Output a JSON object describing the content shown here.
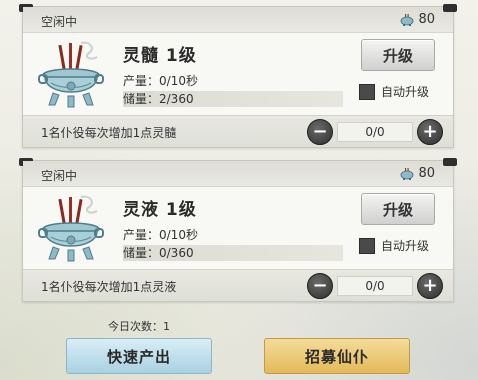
{
  "panels": [
    {
      "status": "空闲中",
      "resource_icon": "censer-icon",
      "resource_amount": "80",
      "title": "灵髓 1级",
      "production": "产量：0/10秒",
      "storage": "储量：2/360",
      "upgrade_label": "升级",
      "auto_upgrade_label": "自动升级",
      "auto_upgrade_checked": false,
      "servant_desc": "1名仆役每次增加1点灵髓",
      "servant_count": "0/0"
    },
    {
      "status": "空闲中",
      "resource_icon": "censer-icon",
      "resource_amount": "80",
      "title": "灵液 1级",
      "production": "产量：0/10秒",
      "storage": "储量：0/360",
      "upgrade_label": "升级",
      "auto_upgrade_label": "自动升级",
      "auto_upgrade_checked": false,
      "servant_desc": "1名仆役每次增加1点灵液",
      "servant_count": "0/0"
    }
  ],
  "stepper_icons": {
    "minus": "minus-icon",
    "plus": "plus-icon"
  },
  "daily_count": "今日次数：1",
  "buttons": {
    "quick_produce": "快速产出",
    "recruit": "招募仙仆"
  },
  "colors": {
    "quick_button": "#a9d1e2",
    "recruit_button": "#e3b95a",
    "checkbox": "#4a4a4a"
  }
}
